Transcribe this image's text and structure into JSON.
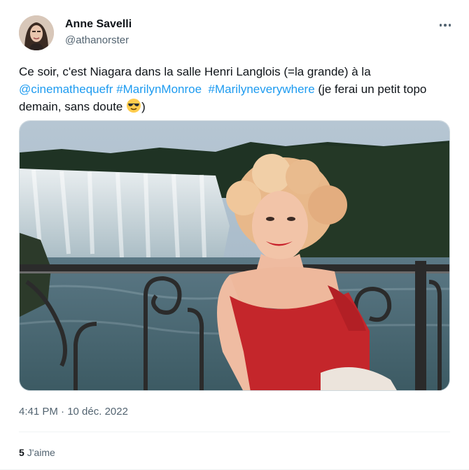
{
  "author": {
    "name": "Anne Savelli",
    "handle": "@athanorster"
  },
  "tweet": {
    "text_before": "Ce soir, c'est Niagara dans la salle Henri Langlois (=la grande) à la ",
    "mention": "@cinemathequefr",
    "hashtag1": "#MarilynMonroe",
    "hashtag2": "#Marilyneverywhere",
    "text_after": " (je ferai un petit topo demain, sans doute ",
    "text_end": ")",
    "emoji": "sunglasses-emoji"
  },
  "media": {
    "description_icon": "photo"
  },
  "meta": {
    "timestamp": "4:41 PM · 10 déc. 2022"
  },
  "engagement": {
    "like_count": "5",
    "like_label": "J'aime"
  },
  "colors": {
    "link": "#1d9bf0",
    "secondary_text": "#536471",
    "primary_text": "#0f1419"
  }
}
